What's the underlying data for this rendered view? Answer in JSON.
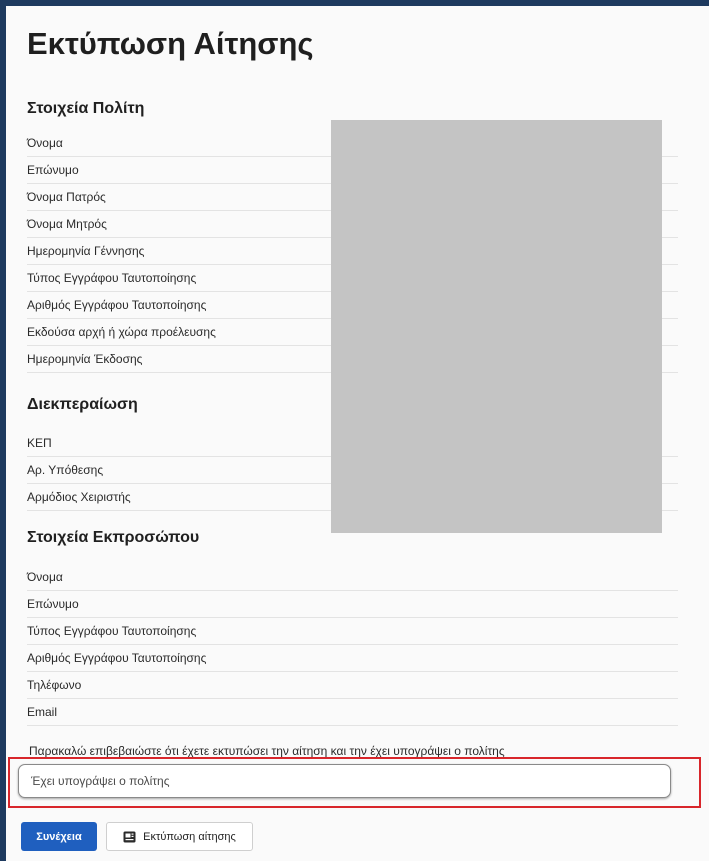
{
  "page": {
    "title": "Εκτύπωση Αίτησης"
  },
  "citizen": {
    "heading": "Στοιχεία Πολίτη",
    "fields": [
      "Όνομα",
      "Επώνυμο",
      "Όνομα Πατρός",
      "Όνομα Μητρός",
      "Ημερομηνία Γέννησης",
      "Τύπος Εγγράφου Ταυτοποίησης",
      "Αριθμός Εγγράφου Ταυτοποίησης",
      "Εκδούσα αρχή ή χώρα προέλευσης",
      "Ημερομηνία Έκδοσης"
    ]
  },
  "processing": {
    "heading": "Διεκπεραίωση",
    "fields": [
      "ΚΕΠ",
      "Αρ. Υπόθεσης",
      "Αρμόδιος Χειριστής"
    ]
  },
  "representative": {
    "heading": "Στοιχεία Εκπροσώπου",
    "fields": [
      "Όνομα",
      "Επώνυμο",
      "Τύπος Εγγράφου Ταυτοποίησης",
      "Αριθμός Εγγράφου Ταυτοποίησης",
      "Τηλέφωνο",
      "Email"
    ]
  },
  "confirmation": {
    "instruction": "Παρακαλώ επιβεβαιώστε ότι έχετε εκτυπώσει την αίτηση και την έχει υπογράψει ο πολίτης",
    "placeholder": "Έχει υπογράψει ο πολίτης",
    "value": ""
  },
  "actions": {
    "continue_label": "Συνέχεια",
    "print_label": "Εκτύπωση αίτησης",
    "print_icon": "print-icon"
  },
  "colors": {
    "frame": "#1e3a5f",
    "primary": "#1f5fbf",
    "highlight": "#d8262b"
  }
}
